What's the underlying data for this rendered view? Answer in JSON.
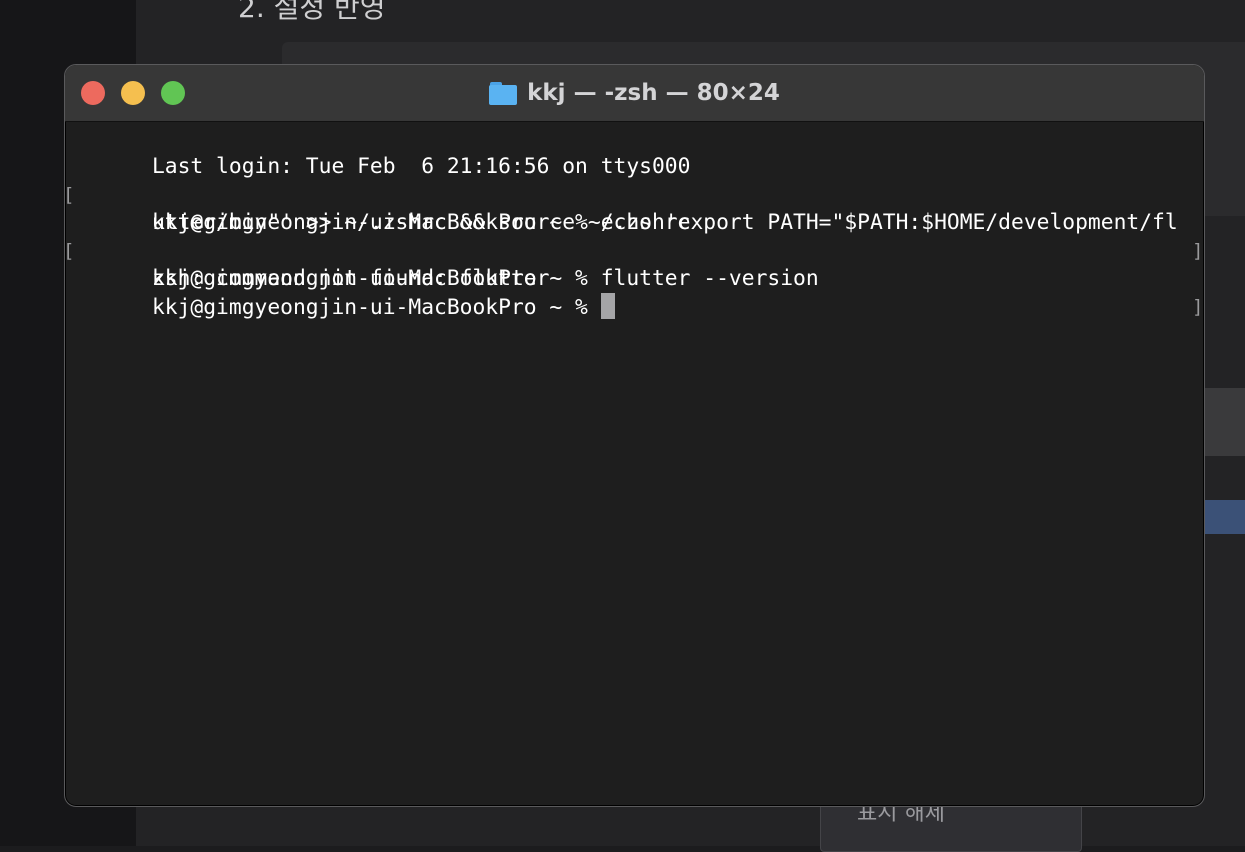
{
  "background": {
    "heading": "2. 설정 반영",
    "bottom_button_label": "표시 해제"
  },
  "window": {
    "title": "kkj — -zsh — 80×24",
    "title_icon": "folder-icon",
    "buttons": {
      "close": "close-button",
      "minimize": "minimize-button",
      "zoom": "zoom-button"
    }
  },
  "terminal": {
    "lines": [
      "Last login: Tue Feb  6 21:16:56 on ttys000",
      "kkj@gimgyeongjin-ui-MacBookPro ~ % echo 'export PATH=\"$PATH:$HOME/development/fl",
      "utter/bin\"' >> ~/.zshrc && source ~/.zshrc",
      "kkj@gimgyeongjin-ui-MacBookPro ~ % flutter --version",
      "zsh: command not found: flutter",
      "kkj@gimgyeongjin-ui-MacBookPro ~ %"
    ],
    "bracket_left": "[",
    "bracket_right": "]"
  },
  "colors": {
    "close": "#ed6a5e",
    "minimize": "#f5bf4f",
    "zoom": "#61c554",
    "terminal_bg": "#1e1e1e",
    "titlebar_bg": "#373737",
    "text": "#ffffff"
  }
}
